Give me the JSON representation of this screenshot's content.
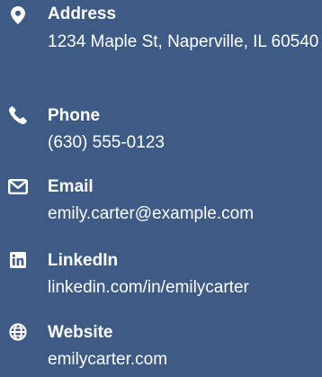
{
  "contact": {
    "items": [
      {
        "icon": "map-marker-icon",
        "label": "Address",
        "value": "1234 Maple St, Naperville, IL 60540"
      },
      {
        "icon": "phone-icon",
        "label": "Phone",
        "value": "(630) 555-0123"
      },
      {
        "icon": "envelope-icon",
        "label": "Email",
        "value": "emily.carter@example.com"
      },
      {
        "icon": "linkedin-icon",
        "label": "LinkedIn",
        "value": "linkedin.com/in/emilycarter"
      },
      {
        "icon": "globe-icon",
        "label": "Website",
        "value": "emilycarter.com"
      }
    ]
  }
}
